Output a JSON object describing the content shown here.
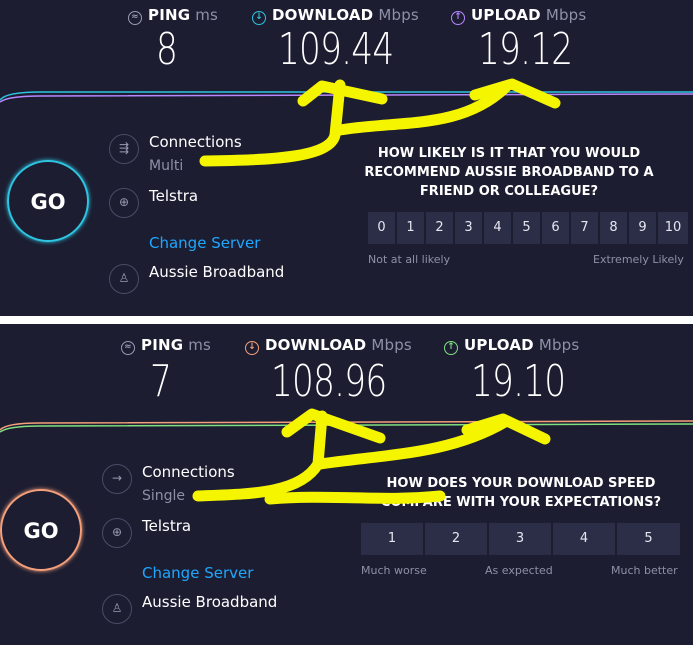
{
  "top": {
    "ping": {
      "label": "PING",
      "unit": "ms",
      "value": "8"
    },
    "download": {
      "label": "DOWNLOAD",
      "unit": "Mbps",
      "value": "109.44"
    },
    "upload": {
      "label": "UPLOAD",
      "unit": "Mbps",
      "value": "19.12"
    },
    "go_label": "GO",
    "connections": {
      "label": "Connections",
      "value": "Multi"
    },
    "isp": "Telstra",
    "change_server": "Change Server",
    "host": "Aussie Broadband",
    "question": "HOW LIKELY IS IT THAT YOU WOULD RECOMMEND AUSSIE BROADBAND TO A FRIEND OR COLLEAGUE?",
    "scale": [
      "0",
      "1",
      "2",
      "3",
      "4",
      "5",
      "6",
      "7",
      "8",
      "9",
      "10"
    ],
    "caption_left": "Not at all likely",
    "caption_right": "Extremely Likely",
    "colors": {
      "accent": "#2ec5e0",
      "download": "#2ec5e0",
      "upload": "#b888ff"
    }
  },
  "bottom": {
    "ping": {
      "label": "PING",
      "unit": "ms",
      "value": "7"
    },
    "download": {
      "label": "DOWNLOAD",
      "unit": "Mbps",
      "value": "108.96"
    },
    "upload": {
      "label": "UPLOAD",
      "unit": "Mbps",
      "value": "19.10"
    },
    "go_label": "GO",
    "connections": {
      "label": "Connections",
      "value": "Single"
    },
    "isp": "Telstra",
    "change_server": "Change Server",
    "host": "Aussie Broadband",
    "question": "HOW DOES YOUR DOWNLOAD SPEED COMPARE WITH YOUR EXPECTATIONS?",
    "scale": [
      "1",
      "2",
      "3",
      "4",
      "5"
    ],
    "caption_left": "Much worse",
    "caption_mid": "As expected",
    "caption_right": "Much better",
    "colors": {
      "accent": "#f49f7a",
      "download": "#f49f7a",
      "upload": "#7fe07f"
    }
  },
  "annotation_color": "#f5f500"
}
